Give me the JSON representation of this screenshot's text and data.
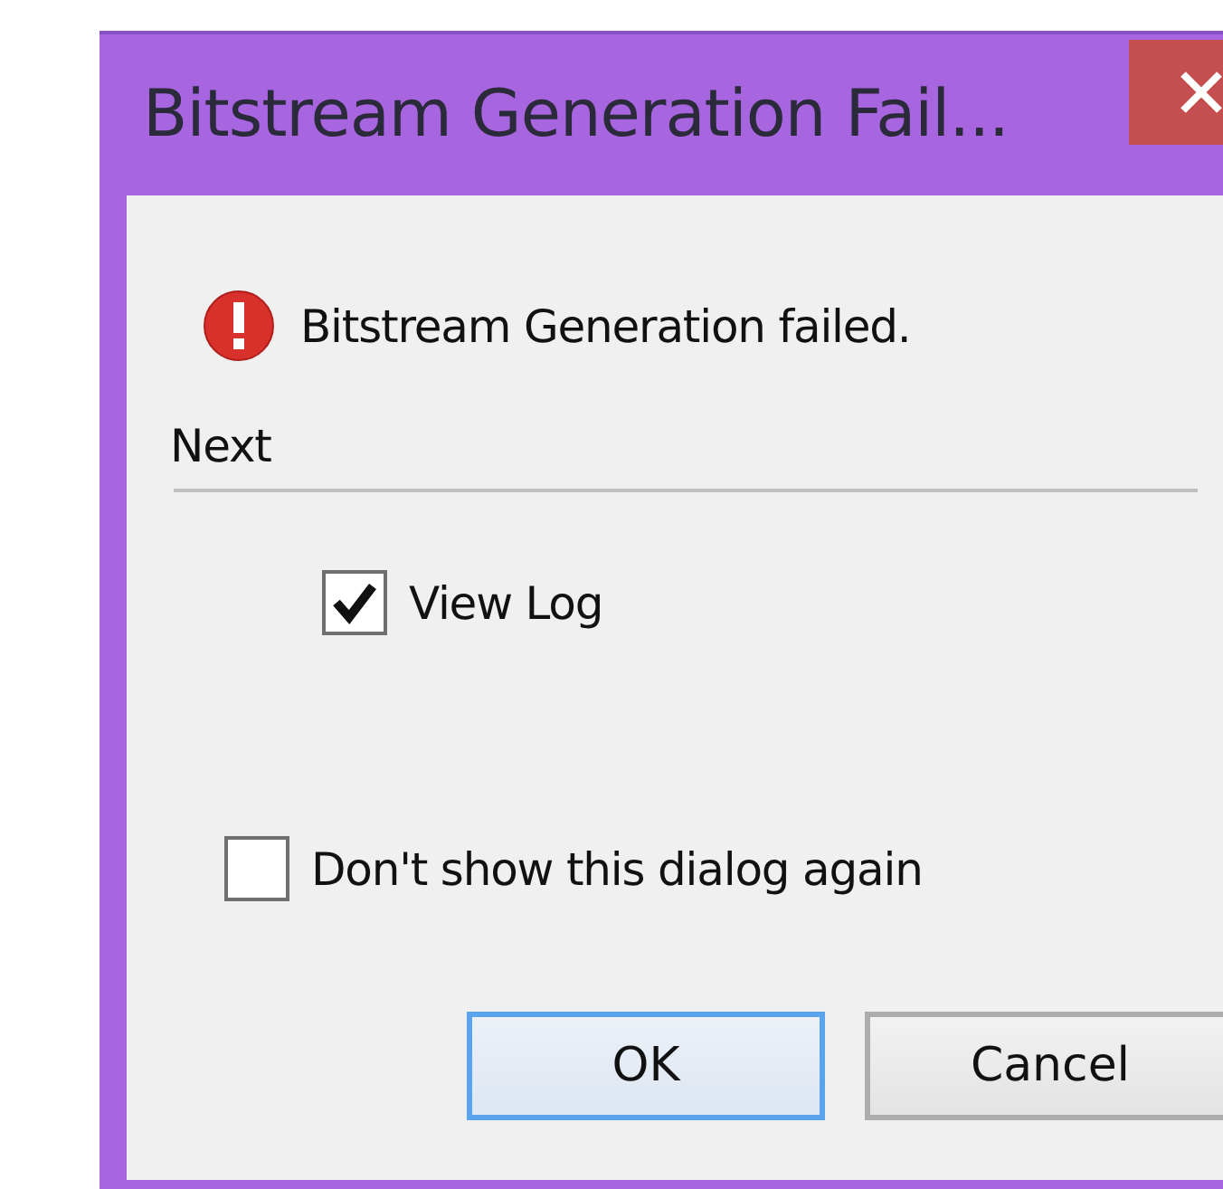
{
  "window": {
    "title": "Bitstream Generation Fail..."
  },
  "message": {
    "kind": "error",
    "text": "Bitstream Generation failed."
  },
  "next_section": {
    "heading": "Next",
    "options": [
      {
        "label": "View Log",
        "checked": true
      }
    ]
  },
  "dont_show_again": {
    "label": "Don't show this dialog again",
    "checked": false
  },
  "buttons": [
    {
      "label": "OK",
      "default": true
    },
    {
      "label": "Cancel",
      "default": false
    }
  ]
}
